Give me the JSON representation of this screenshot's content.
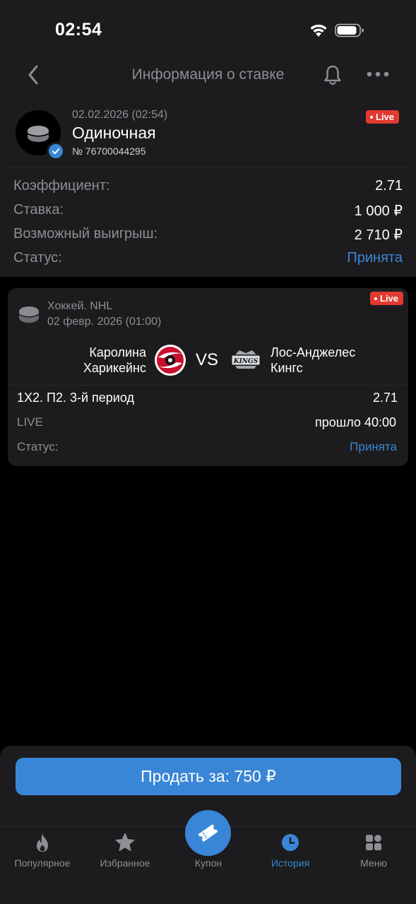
{
  "status_bar": {
    "time": "02:54"
  },
  "nav": {
    "title": "Информация о ставке"
  },
  "bet": {
    "date": "02.02.2026 (02:54)",
    "type": "Одиночная",
    "number": "№ 76700044295",
    "live_badge": "Live",
    "rows": [
      {
        "label": "Коэффициент:",
        "value": "2.71"
      },
      {
        "label": "Ставка:",
        "value": "1 000 ₽"
      },
      {
        "label": "Возможный выигрыш:",
        "value": "2 710 ₽"
      },
      {
        "label": "Статус:",
        "value": "Принята"
      }
    ]
  },
  "event": {
    "league": "Хоккей. NHL",
    "date": "02 февр. 2026 (01:00)",
    "live_badge": "Live",
    "home_team_line1": "Каролина",
    "home_team_line2": "Харикейнс",
    "vs": "VS",
    "away_team_line1": "Лос-Анджелес",
    "away_team_line2": "Кингс",
    "away_logo_text": "KINGS",
    "selection": "1X2. П2. 3-й период",
    "odds": "2.71",
    "live_label": "LIVE",
    "elapsed": "прошло 40:00",
    "status_label": "Статус:",
    "status_value": "Принята"
  },
  "sell_button": "Продать за: 750 ₽",
  "tabs": [
    {
      "label": "Популярное",
      "icon": "flame-icon"
    },
    {
      "label": "Избранное",
      "icon": "star-icon"
    },
    {
      "label": "Купон",
      "icon": "ticket-icon"
    },
    {
      "label": "История",
      "icon": "clock-icon"
    },
    {
      "label": "Меню",
      "icon": "grid-icon"
    }
  ],
  "colors": {
    "accent": "#3a86d6",
    "live": "#e23a32",
    "surface": "#1c1c1e",
    "background": "#000000",
    "muted": "#8e8e93"
  }
}
